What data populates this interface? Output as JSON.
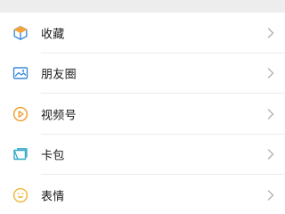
{
  "menu": {
    "items": [
      {
        "label": "收藏",
        "icon": "favorites-cube-icon"
      },
      {
        "label": "朋友圈",
        "icon": "moments-image-icon"
      },
      {
        "label": "视频号",
        "icon": "channels-play-icon"
      },
      {
        "label": "卡包",
        "icon": "card-wallet-icon"
      },
      {
        "label": "表情",
        "icon": "sticker-smile-icon"
      }
    ]
  },
  "colors": {
    "background": "#ededed",
    "row_bg": "#ffffff",
    "favorites_orange": "#f3a33a",
    "favorites_blue": "#3e8ede",
    "moments_blue": "#3b8ad8",
    "channels_orange": "#f09b2a",
    "card_teal": "#2ea7c9",
    "sticker_yellow": "#f2b532",
    "chevron": "#b2b2b2",
    "text": "#191919"
  }
}
